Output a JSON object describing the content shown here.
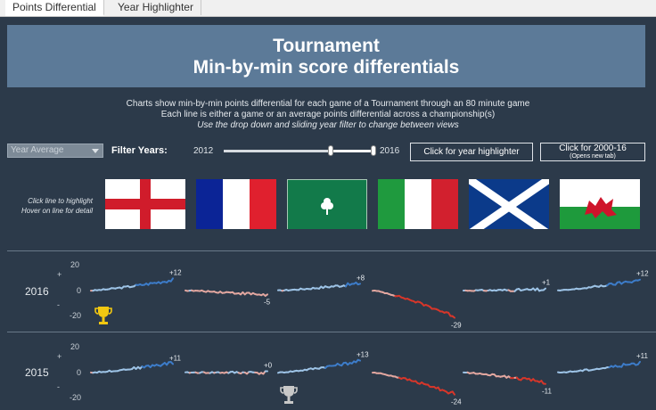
{
  "tabs": [
    {
      "label": "Points Differential",
      "active": true
    },
    {
      "label": "Year Highlighter",
      "active": false
    }
  ],
  "header": {
    "title_line1": "Tournament",
    "title_line2": "Min-by-min score differentials"
  },
  "description": {
    "line1": "Charts show min-by-min points differential for each game of a Tournament through an 80 minute game",
    "line2": "Each line is either a game or an average points differential across a championship(s)",
    "line3": "Use the drop down and sliding year filter to change between views"
  },
  "controls": {
    "dropdown_value": "Year Average",
    "filter_label": "Filter Years:",
    "year_min": "2012",
    "year_max": "2016",
    "year_highlighter_button": "Click for year highlighter",
    "history_button": "Click for 2000-16",
    "history_button_note": "(Opens new tab)"
  },
  "hint": {
    "line1": "Click line to highlight",
    "line2": "Hover on line for detail"
  },
  "flags": [
    "england",
    "france",
    "ireland",
    "italy",
    "scotland",
    "wales"
  ],
  "colors": {
    "accent_blue": "#3d7cc9",
    "accent_red": "#d7362a",
    "light_pink": "#e3a7a0",
    "light_blue": "#9dc3e6",
    "gold_trophy": "#f2c811",
    "silver_trophy": "#c8c8c8"
  },
  "axis": {
    "top_tick": "20",
    "mid_tick": "0",
    "bottom_tick": "-20",
    "plus": "+",
    "minus": "-"
  },
  "rows": [
    {
      "year": "2016",
      "trophy": "gold",
      "trophy_team": "england",
      "final_labels": [
        "+12",
        "-5",
        "+8",
        "-29",
        "+1",
        "+12"
      ],
      "finals": [
        12,
        -5,
        8,
        -29,
        1,
        12
      ]
    },
    {
      "year": "2015",
      "trophy": "silver",
      "trophy_team": "ireland",
      "final_labels": [
        "+11",
        "+0",
        "+13",
        "-24",
        "-11",
        "+11"
      ],
      "finals": [
        11,
        0,
        13,
        -24,
        -11,
        11
      ]
    }
  ]
}
